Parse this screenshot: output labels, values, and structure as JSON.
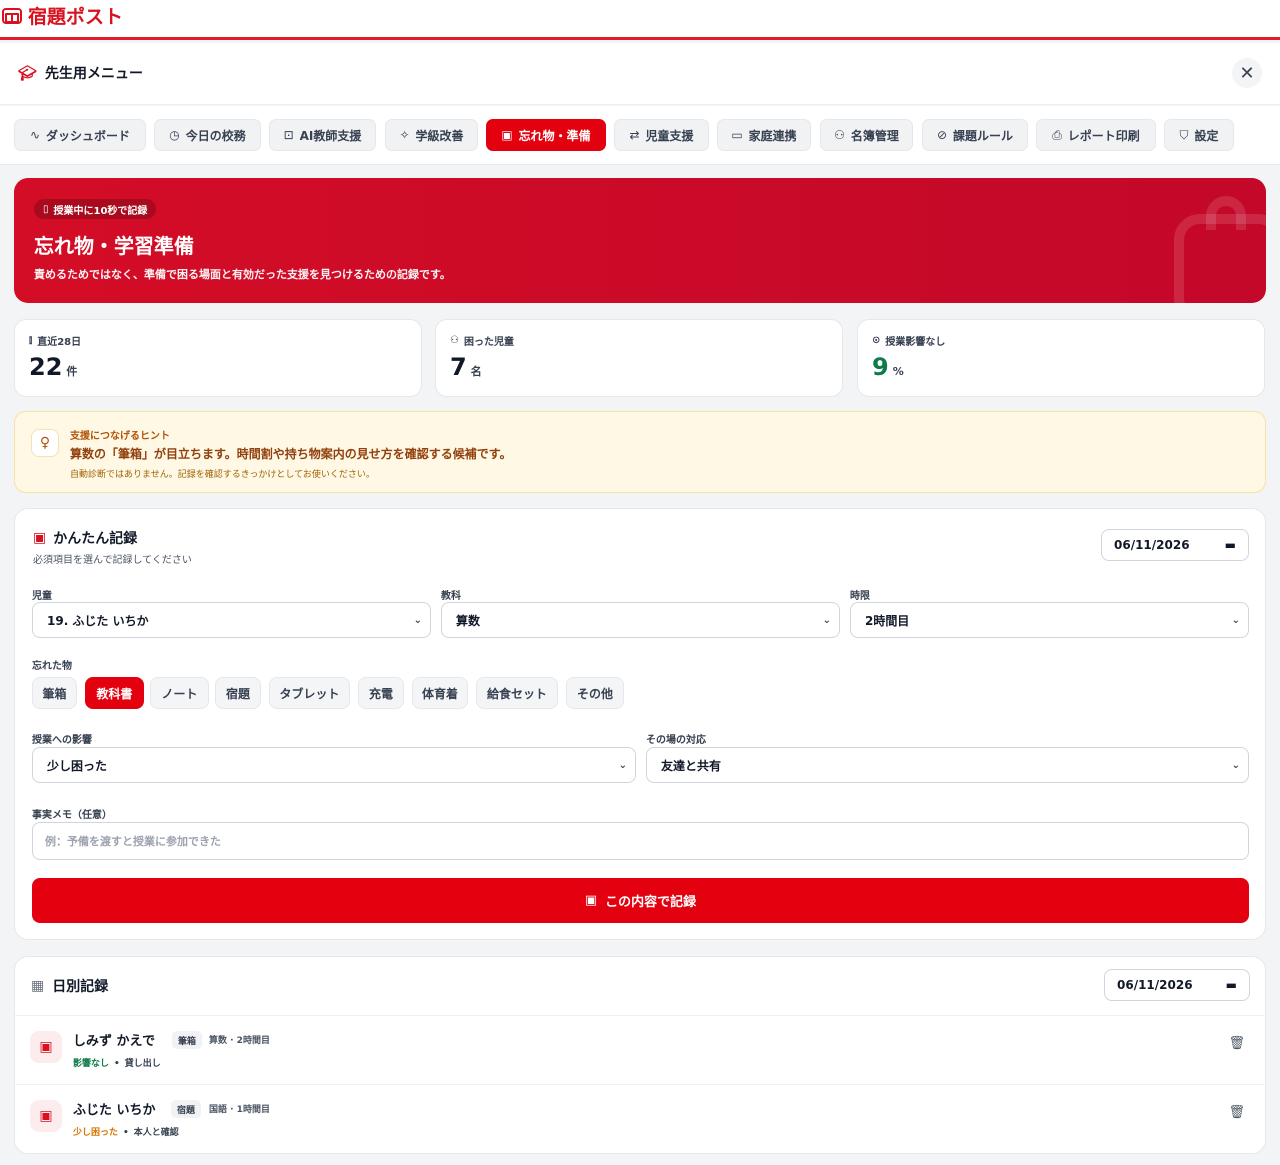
{
  "app": {
    "name": "宿題ポスト"
  },
  "menu": {
    "title": "先生用メニュー"
  },
  "tabs": [
    {
      "label": "ダッシュボード",
      "icon": "activity-icon"
    },
    {
      "label": "今日の校務",
      "icon": "clock-icon"
    },
    {
      "label": "AI教師支援",
      "icon": "robot-icon"
    },
    {
      "label": "学級改善",
      "icon": "sparkles-icon"
    },
    {
      "label": "忘れ物・準備",
      "icon": "backpack-icon",
      "active": true
    },
    {
      "label": "児童支援",
      "icon": "handshake-icon"
    },
    {
      "label": "家庭連携",
      "icon": "message-icon"
    },
    {
      "label": "名簿管理",
      "icon": "users-icon"
    },
    {
      "label": "課題ルール",
      "icon": "check-circle-icon"
    },
    {
      "label": "レポート印刷",
      "icon": "printer-icon"
    },
    {
      "label": "設定",
      "icon": "shield-icon"
    }
  ],
  "hero": {
    "badge": "授業中に10秒で記録",
    "title": "忘れ物・学習準備",
    "subtitle": "責めるためではなく、準備で困る場面と有効だった支援を見つけるための記録です。"
  },
  "stats": [
    {
      "label": "直近28日",
      "value": "22",
      "unit": "件",
      "icon": "bar-chart-icon"
    },
    {
      "label": "困った児童",
      "value": "7",
      "unit": "名",
      "icon": "users-icon"
    },
    {
      "label": "授業影響なし",
      "value": "9",
      "unit": "%",
      "icon": "check-circle-icon",
      "color": "#0f7b4a"
    }
  ],
  "hint": {
    "title": "支援につなげるヒント",
    "message": "算数の「筆箱」が目立ちます。時間割や持ち物案内の見せ方を確認する候補です。",
    "note": "自動診断ではありません。記録を確認するきっかけとしてお使いください。"
  },
  "form": {
    "title": "かんたん記録",
    "subtitle": "必須項目を選んで記録してください",
    "date": "06/11/2026",
    "student_label": "児童",
    "student_value": "19. ふじた いちか",
    "subject_label": "教科",
    "subject_value": "算数",
    "period_label": "時限",
    "period_value": "2時間目",
    "items_label": "忘れた物",
    "items": [
      {
        "label": "筆箱"
      },
      {
        "label": "教科書",
        "active": true
      },
      {
        "label": "ノート"
      },
      {
        "label": "宿題"
      },
      {
        "label": "タブレット"
      },
      {
        "label": "充電"
      },
      {
        "label": "体育着"
      },
      {
        "label": "給食セット"
      },
      {
        "label": "その他"
      }
    ],
    "impact_label": "授業への影響",
    "impact_value": "少し困った",
    "response_label": "その場の対応",
    "response_value": "友達と共有",
    "memo_label": "事実メモ（任意）",
    "memo_placeholder": "例：予備を渡すと授業に参加できた",
    "submit_label": "この内容で記録"
  },
  "log": {
    "title": "日別記録",
    "date": "06/11/2026",
    "rows": [
      {
        "name": "しみず かえで",
        "item": "筆箱",
        "meta": "算数 · 2時間目",
        "impact": "影響なし",
        "impact_color": "#0f7b4a",
        "action": "貸し出し"
      },
      {
        "name": "ふじた いちか",
        "item": "宿題",
        "meta": "国語 · 1時間目",
        "impact": "少し困った",
        "impact_color": "#d97706",
        "action": "本人と確認"
      }
    ]
  },
  "colors": {
    "accent": "#e3000f",
    "hero": "#c90a28",
    "success": "#0f7b4a",
    "warning": "#d97706"
  }
}
